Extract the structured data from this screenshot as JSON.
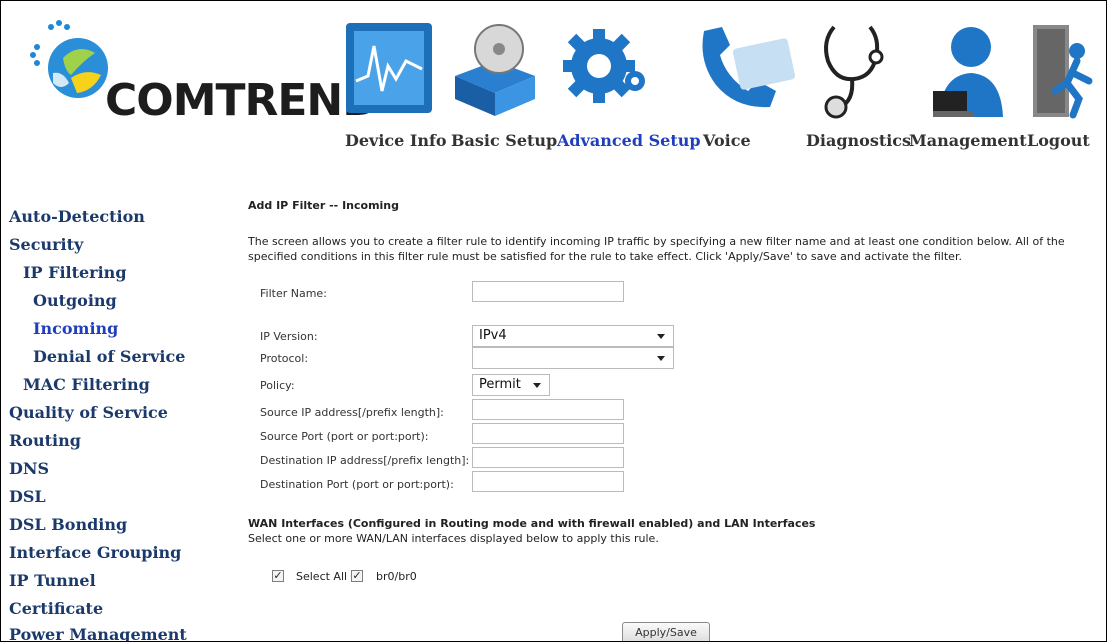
{
  "brand": {
    "name": "COMTREND"
  },
  "nav": [
    {
      "id": "device-info",
      "label": "Device Info",
      "icon": "chart-monitor-icon"
    },
    {
      "id": "basic-setup",
      "label": "Basic Setup",
      "icon": "disc-box-icon"
    },
    {
      "id": "advanced-setup",
      "label": "Advanced Setup",
      "icon": "gear-icon"
    },
    {
      "id": "voice",
      "label": "Voice",
      "icon": "phone-handset-icon"
    },
    {
      "id": "diagnostics",
      "label": "Diagnostics",
      "icon": "stethoscope-icon"
    },
    {
      "id": "management",
      "label": "Management",
      "icon": "user-laptop-icon"
    },
    {
      "id": "logout",
      "label": "Logout",
      "icon": "exit-door-icon"
    }
  ],
  "sidebar": {
    "items": [
      {
        "label": "Auto-Detection"
      },
      {
        "label": "Security"
      },
      {
        "label": "IP Filtering"
      },
      {
        "label": "Outgoing"
      },
      {
        "label": "Incoming"
      },
      {
        "label": "Denial of Service"
      },
      {
        "label": "MAC Filtering"
      },
      {
        "label": "Quality of Service"
      },
      {
        "label": "Routing"
      },
      {
        "label": "DNS"
      },
      {
        "label": "DSL"
      },
      {
        "label": "DSL Bonding"
      },
      {
        "label": "Interface Grouping"
      },
      {
        "label": "IP Tunnel"
      },
      {
        "label": "Certificate"
      },
      {
        "label": "Power Management"
      }
    ]
  },
  "content": {
    "title": "Add IP Filter -- Incoming",
    "description": "The screen allows you to create a filter rule to identify incoming IP traffic by specifying a new filter name and at least one condition below. All of the specified conditions in this filter rule must be satisfied for the rule to take effect. Click 'Apply/Save' to save and activate the filter.",
    "fields": {
      "filter_name": {
        "label": "Filter Name:",
        "value": ""
      },
      "ip_version": {
        "label": "IP Version:",
        "value": "IPv4"
      },
      "protocol": {
        "label": "Protocol:",
        "value": ""
      },
      "policy": {
        "label": "Policy:",
        "value": "Permit"
      },
      "src_ip": {
        "label": "Source IP address[/prefix length]:",
        "value": ""
      },
      "src_port": {
        "label": "Source Port (port or port:port):",
        "value": ""
      },
      "dst_ip": {
        "label": "Destination IP address[/prefix length]:",
        "value": ""
      },
      "dst_port": {
        "label": "Destination Port (port or port:port):",
        "value": ""
      }
    },
    "wan_heading": "WAN Interfaces (Configured in Routing mode and with firewall enabled) and LAN Interfaces",
    "wan_sub": "Select one or more WAN/LAN interfaces displayed below to apply this rule.",
    "select_all": {
      "label": "Select All",
      "checked": true
    },
    "iface": {
      "label": "br0/br0",
      "checked": true
    },
    "apply_label": "Apply/Save"
  },
  "colors": {
    "accent": "#1f3fbf",
    "sidebar_text": "#1b3a6b"
  }
}
